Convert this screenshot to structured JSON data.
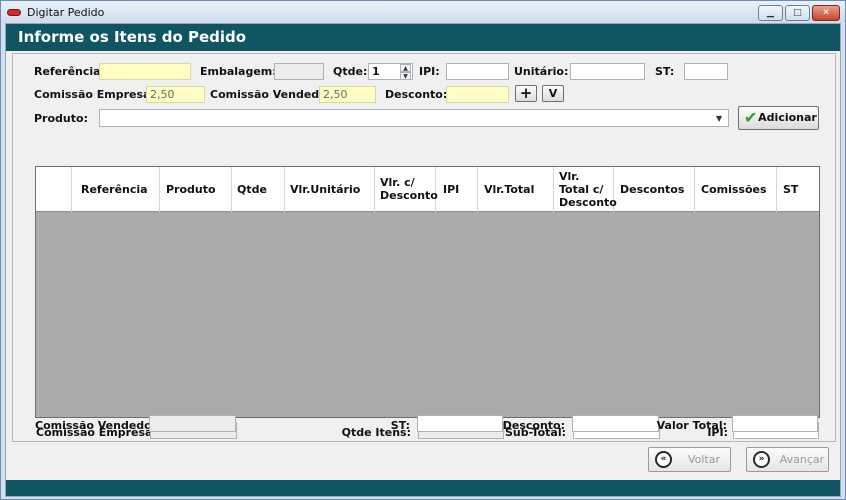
{
  "window": {
    "title": "Digitar Pedido",
    "min": "▁",
    "max": "□",
    "close": "✕"
  },
  "header": {
    "title": "Informe os Itens do Pedido"
  },
  "form": {
    "referencia_label": "Referência:",
    "embalagem_label": "Embalagem:",
    "qtde_label": "Qtde:",
    "qtde_value": "1",
    "ipi_label": "IPI:",
    "unitario_label": "Unitário:",
    "st_label": "ST:",
    "comissao_empresa_label": "Comissão Empresa:",
    "comissao_empresa_value": "2,50",
    "comissao_vendedor_label": "Comissão Vendedor:",
    "comissao_vendedor_value": "2,50",
    "desconto_label": "Desconto:",
    "plus_button": "+",
    "v_button": "V",
    "produto_label": "Produto:",
    "adicionar_button": "Adicionar"
  },
  "grid": {
    "columns": [
      "Referência",
      "Produto",
      "Qtde",
      "Vlr.Unitário",
      "Vlr. c/ Desconto",
      "IPI",
      "Vlr.Total",
      "Vlr. Total c/ Desconto",
      "Descontos",
      "Comissões",
      "ST"
    ],
    "column_lines": {
      "desconto": [
        "Vlr. c/",
        "Desconto"
      ],
      "total_desconto": [
        "Vlr.",
        "Total c/",
        "Desconto"
      ]
    },
    "rows": []
  },
  "totals": {
    "comissao_empresa_label": "Comissão Empresa:",
    "comissao_vendedor_label": "Comissão Vendedor:",
    "qtde_itens_label": "Qtde Itens:",
    "st_label": "ST:",
    "subtotal_label": "Sub-Total:",
    "desconto_label": "Desconto:",
    "ipi_label": "IPI:",
    "valor_total_label": "Valor Total:"
  },
  "footer": {
    "voltar": "Voltar",
    "avancar": "Avançar"
  },
  "colors": {
    "accent": "#0f5662",
    "highlight_field": "#ffffc4",
    "grid_background": "#ababab"
  }
}
